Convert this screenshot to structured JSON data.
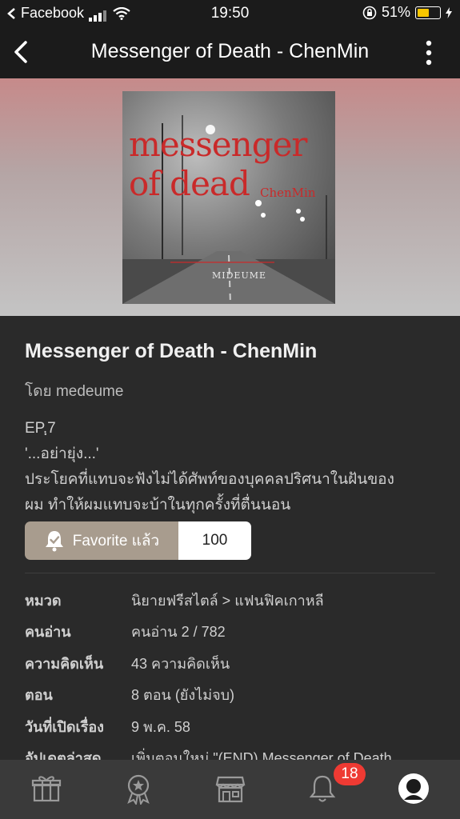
{
  "status_bar": {
    "back_app": "Facebook",
    "time": "19:50",
    "battery": "51%"
  },
  "navbar": {
    "title": "Messenger of Death - ChenMin"
  },
  "cover": {
    "title_text": "messenger of dead",
    "author_text": "ChenMin",
    "signature_text": "MIDEUME"
  },
  "story": {
    "title": "Messenger of Death - ChenMin",
    "author_line": "โดย medeume",
    "desc_lines": [
      "EP.ฺ7",
      "'...อย่ายุ่ง...'",
      "ประโยคที่แทบจะฟังไม่ได้ศัพท์ของบุคคลปริศนาในฝันของ",
      "ผม ทำให้ผมแทบจะบ้าในทุกครั้งที่ตื่นนอน"
    ],
    "favorite_label": "Favorite แล้ว",
    "favorite_count": "100"
  },
  "info": [
    {
      "label": "หมวด",
      "value": "นิยายฟรีสไตล์ > แฟนฟิคเกาหลี"
    },
    {
      "label": "คนอ่าน",
      "value": "คนอ่าน 2 / 782"
    },
    {
      "label": "ความคิดเห็น",
      "value": "43 ความคิดเห็น"
    },
    {
      "label": "ตอน",
      "value": "8 ตอน (ยังไม่จบ)"
    },
    {
      "label": "วันที่เปิดเรื่อง",
      "value": "9 พ.ค. 58"
    },
    {
      "label": "อัปเดตล่าสุด",
      "value": "เพิ่มตอนใหม่ \"(END) Messenger of Death"
    }
  ],
  "tabbar": {
    "notification_badge": "18",
    "icons": [
      "gift-icon",
      "award-icon",
      "store-icon",
      "bell-icon",
      "profile-icon"
    ]
  },
  "colors": {
    "accent_badge": "#ee3a33",
    "favorite_button": "#a89c8e",
    "battery": "#f7c600"
  }
}
